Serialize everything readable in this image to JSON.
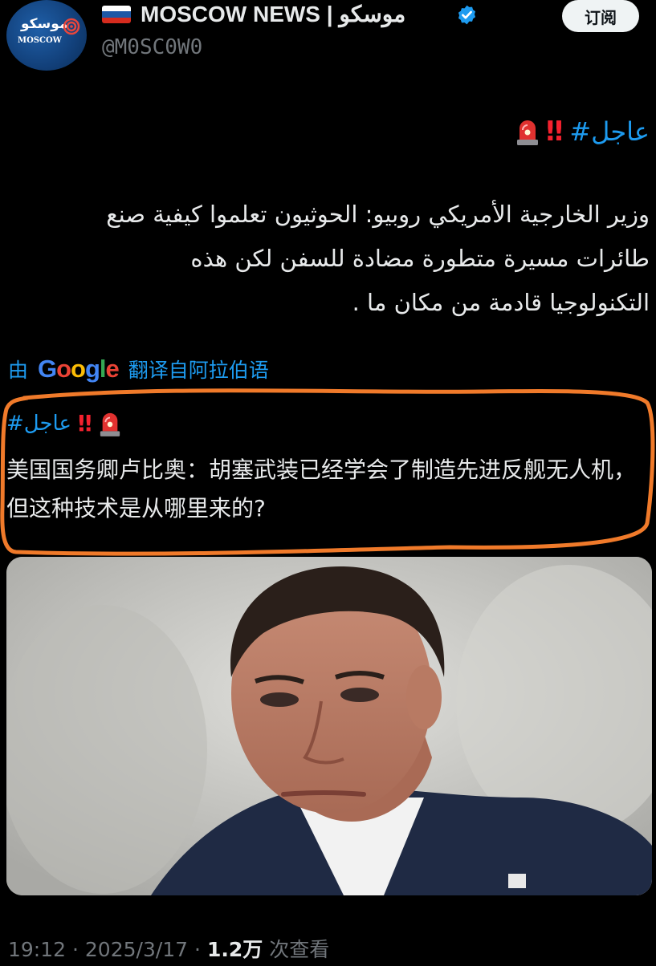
{
  "header": {
    "avatar_logo_arabic": "موسكو",
    "avatar_logo_latin": "MOSCOW",
    "display_name": "MOSCOW NEWS | موسكو",
    "handle": "@M0SC0W0",
    "subscribe_label": "订阅"
  },
  "tweet": {
    "arabic_hashtag": "#عاجل",
    "arabic_text": "وزير الخارجية الأمريكي روبيو: الحوثيون تعلموا كيفية صنع\nطائرات مسيرة متطورة مضادة للسفن لكن هذه\nالتكنولوجيا قادمة من مكان ما .",
    "translation_prefix": "由",
    "translation_brand": "Google",
    "translation_suffix": "翻译自阿拉伯语",
    "translated_hashtag": "#عاجل",
    "translated_text": "美国国务卿卢比奥：胡塞武装已经学会了制造先进反舰无人机，但这种技术是从哪里来的?"
  },
  "meta": {
    "time": "19:12",
    "separator": "·",
    "date": "2025/3/17",
    "views_count": "1.2万",
    "views_label": "次查看"
  },
  "colors": {
    "background": "#000000",
    "link_blue": "#1d9bf0",
    "alert_red": "#f4212e",
    "annotation_orange": "#f07a2a"
  },
  "icons": {
    "flag": "russia-flag-icon",
    "verified": "verified-badge-icon",
    "siren": "police-siren-icon"
  }
}
